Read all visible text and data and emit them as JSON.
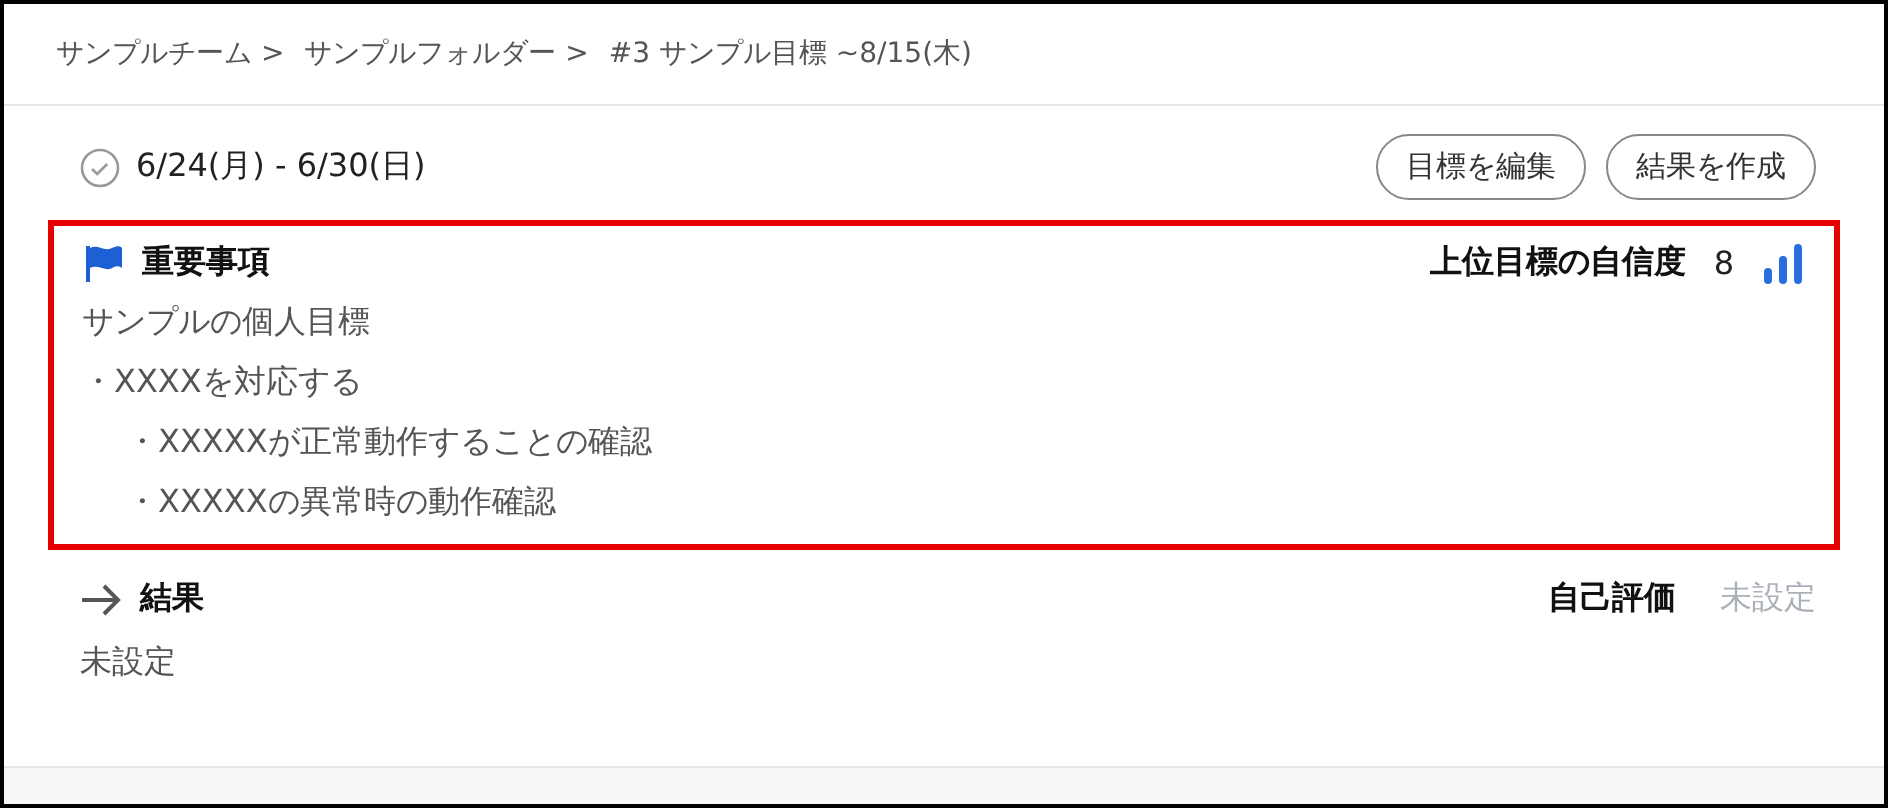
{
  "breadcrumb": [
    "サンプルチーム >",
    "サンプルフォルダー >",
    "#3 サンプル目標 ~8/15(木)"
  ],
  "period": {
    "label": "6/24(月) - 6/30(日)",
    "done": false
  },
  "buttons": [
    "目標を編集",
    "結果を作成"
  ],
  "key_items": {
    "title": "重要事項",
    "confidence_label": "上位目標の自信度",
    "confidence_value": "8",
    "description": "サンプルの個人目標",
    "items": [
      {
        "text": "・XXXXを対応する",
        "children": [
          {
            "text": "・XXXXXが正常動作することの確認"
          },
          {
            "text": "・XXXXXの異常時の動作確認"
          }
        ]
      }
    ]
  },
  "results": {
    "title": "結果",
    "self_rating_label": "自己評価",
    "self_rating_value": "未設定",
    "body": "未設定"
  }
}
